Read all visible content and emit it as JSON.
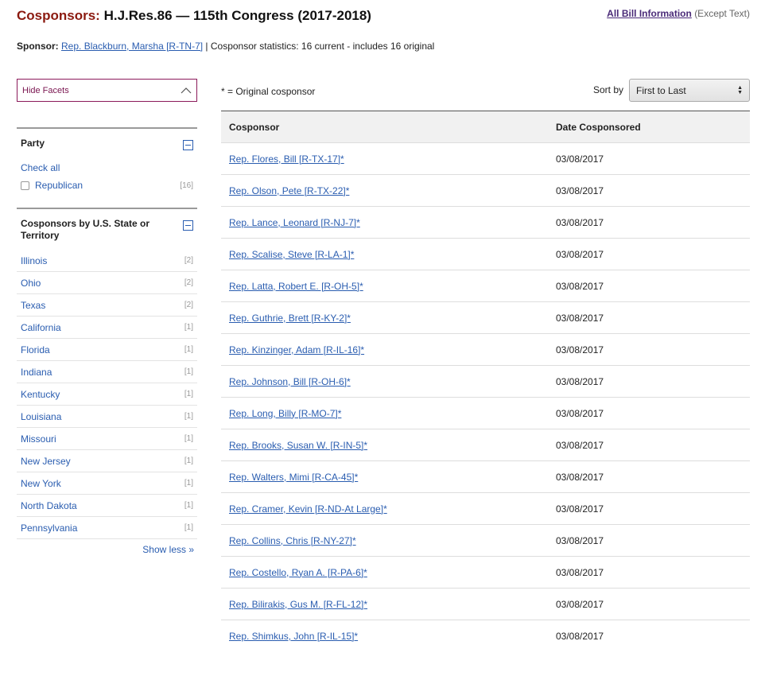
{
  "header": {
    "title_prefix": "Cosponsors:",
    "title_bill": "H.J.Res.86 — 115th Congress (2017-2018)",
    "all_info_link": "All Bill Information",
    "all_info_note": "(Except Text)"
  },
  "sponsor": {
    "label": "Sponsor:",
    "name": "Rep. Blackburn, Marsha [R-TN-7]",
    "stats": "| Cosponsor statistics: 16 current - includes 16 original"
  },
  "sidebar": {
    "hide_facets": "Hide Facets",
    "party": {
      "title": "Party",
      "check_all": "Check all",
      "items": [
        {
          "label": "Republican",
          "count": "[16]"
        }
      ]
    },
    "states": {
      "title": "Cosponsors by U.S. State or Territory",
      "items": [
        {
          "label": "Illinois",
          "count": "[2]"
        },
        {
          "label": "Ohio",
          "count": "[2]"
        },
        {
          "label": "Texas",
          "count": "[2]"
        },
        {
          "label": "California",
          "count": "[1]"
        },
        {
          "label": "Florida",
          "count": "[1]"
        },
        {
          "label": "Indiana",
          "count": "[1]"
        },
        {
          "label": "Kentucky",
          "count": "[1]"
        },
        {
          "label": "Louisiana",
          "count": "[1]"
        },
        {
          "label": "Missouri",
          "count": "[1]"
        },
        {
          "label": "New Jersey",
          "count": "[1]"
        },
        {
          "label": "New York",
          "count": "[1]"
        },
        {
          "label": "North Dakota",
          "count": "[1]"
        },
        {
          "label": "Pennsylvania",
          "count": "[1]"
        }
      ],
      "show_less": "Show less »"
    }
  },
  "main": {
    "legend": "* = Original cosponsor",
    "sort_label": "Sort by",
    "sort_value": "First to Last",
    "columns": [
      "Cosponsor",
      "Date Cosponsored"
    ],
    "rows": [
      {
        "name": "Rep. Flores, Bill [R-TX-17]*",
        "date": "03/08/2017"
      },
      {
        "name": "Rep. Olson, Pete [R-TX-22]*",
        "date": "03/08/2017"
      },
      {
        "name": "Rep. Lance, Leonard [R-NJ-7]*",
        "date": "03/08/2017"
      },
      {
        "name": "Rep. Scalise, Steve [R-LA-1]*",
        "date": "03/08/2017"
      },
      {
        "name": "Rep. Latta, Robert E. [R-OH-5]*",
        "date": "03/08/2017"
      },
      {
        "name": "Rep. Guthrie, Brett [R-KY-2]*",
        "date": "03/08/2017"
      },
      {
        "name": "Rep. Kinzinger, Adam [R-IL-16]*",
        "date": "03/08/2017"
      },
      {
        "name": "Rep. Johnson, Bill [R-OH-6]*",
        "date": "03/08/2017"
      },
      {
        "name": "Rep. Long, Billy [R-MO-7]*",
        "date": "03/08/2017"
      },
      {
        "name": "Rep. Brooks, Susan W. [R-IN-5]*",
        "date": "03/08/2017"
      },
      {
        "name": "Rep. Walters, Mimi [R-CA-45]*",
        "date": "03/08/2017"
      },
      {
        "name": "Rep. Cramer, Kevin [R-ND-At Large]*",
        "date": "03/08/2017"
      },
      {
        "name": "Rep. Collins, Chris [R-NY-27]*",
        "date": "03/08/2017"
      },
      {
        "name": "Rep. Costello, Ryan A. [R-PA-6]*",
        "date": "03/08/2017"
      },
      {
        "name": "Rep. Bilirakis, Gus M. [R-FL-12]*",
        "date": "03/08/2017"
      },
      {
        "name": "Rep. Shimkus, John [R-IL-15]*",
        "date": "03/08/2017"
      }
    ]
  },
  "colors": {
    "accent": "#8b1a10",
    "link": "#2a5db0",
    "facet_border": "#8b1a5a"
  }
}
